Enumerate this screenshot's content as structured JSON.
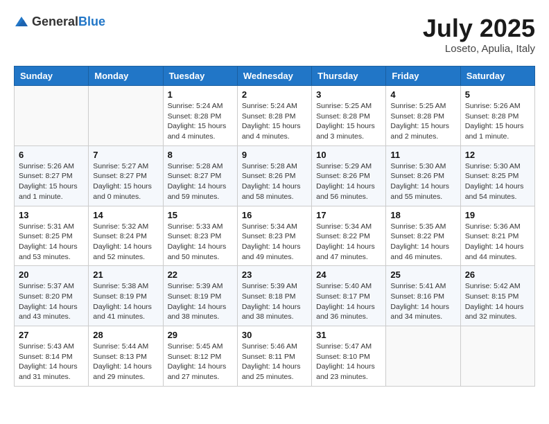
{
  "header": {
    "logo_general": "General",
    "logo_blue": "Blue",
    "month_year": "July 2025",
    "location": "Loseto, Apulia, Italy"
  },
  "weekdays": [
    "Sunday",
    "Monday",
    "Tuesday",
    "Wednesday",
    "Thursday",
    "Friday",
    "Saturday"
  ],
  "weeks": [
    [
      {
        "day": "",
        "sunrise": "",
        "sunset": "",
        "daylight": ""
      },
      {
        "day": "",
        "sunrise": "",
        "sunset": "",
        "daylight": ""
      },
      {
        "day": "1",
        "sunrise": "Sunrise: 5:24 AM",
        "sunset": "Sunset: 8:28 PM",
        "daylight": "Daylight: 15 hours and 4 minutes."
      },
      {
        "day": "2",
        "sunrise": "Sunrise: 5:24 AM",
        "sunset": "Sunset: 8:28 PM",
        "daylight": "Daylight: 15 hours and 4 minutes."
      },
      {
        "day": "3",
        "sunrise": "Sunrise: 5:25 AM",
        "sunset": "Sunset: 8:28 PM",
        "daylight": "Daylight: 15 hours and 3 minutes."
      },
      {
        "day": "4",
        "sunrise": "Sunrise: 5:25 AM",
        "sunset": "Sunset: 8:28 PM",
        "daylight": "Daylight: 15 hours and 2 minutes."
      },
      {
        "day": "5",
        "sunrise": "Sunrise: 5:26 AM",
        "sunset": "Sunset: 8:28 PM",
        "daylight": "Daylight: 15 hours and 1 minute."
      }
    ],
    [
      {
        "day": "6",
        "sunrise": "Sunrise: 5:26 AM",
        "sunset": "Sunset: 8:27 PM",
        "daylight": "Daylight: 15 hours and 1 minute."
      },
      {
        "day": "7",
        "sunrise": "Sunrise: 5:27 AM",
        "sunset": "Sunset: 8:27 PM",
        "daylight": "Daylight: 15 hours and 0 minutes."
      },
      {
        "day": "8",
        "sunrise": "Sunrise: 5:28 AM",
        "sunset": "Sunset: 8:27 PM",
        "daylight": "Daylight: 14 hours and 59 minutes."
      },
      {
        "day": "9",
        "sunrise": "Sunrise: 5:28 AM",
        "sunset": "Sunset: 8:26 PM",
        "daylight": "Daylight: 14 hours and 58 minutes."
      },
      {
        "day": "10",
        "sunrise": "Sunrise: 5:29 AM",
        "sunset": "Sunset: 8:26 PM",
        "daylight": "Daylight: 14 hours and 56 minutes."
      },
      {
        "day": "11",
        "sunrise": "Sunrise: 5:30 AM",
        "sunset": "Sunset: 8:26 PM",
        "daylight": "Daylight: 14 hours and 55 minutes."
      },
      {
        "day": "12",
        "sunrise": "Sunrise: 5:30 AM",
        "sunset": "Sunset: 8:25 PM",
        "daylight": "Daylight: 14 hours and 54 minutes."
      }
    ],
    [
      {
        "day": "13",
        "sunrise": "Sunrise: 5:31 AM",
        "sunset": "Sunset: 8:25 PM",
        "daylight": "Daylight: 14 hours and 53 minutes."
      },
      {
        "day": "14",
        "sunrise": "Sunrise: 5:32 AM",
        "sunset": "Sunset: 8:24 PM",
        "daylight": "Daylight: 14 hours and 52 minutes."
      },
      {
        "day": "15",
        "sunrise": "Sunrise: 5:33 AM",
        "sunset": "Sunset: 8:23 PM",
        "daylight": "Daylight: 14 hours and 50 minutes."
      },
      {
        "day": "16",
        "sunrise": "Sunrise: 5:34 AM",
        "sunset": "Sunset: 8:23 PM",
        "daylight": "Daylight: 14 hours and 49 minutes."
      },
      {
        "day": "17",
        "sunrise": "Sunrise: 5:34 AM",
        "sunset": "Sunset: 8:22 PM",
        "daylight": "Daylight: 14 hours and 47 minutes."
      },
      {
        "day": "18",
        "sunrise": "Sunrise: 5:35 AM",
        "sunset": "Sunset: 8:22 PM",
        "daylight": "Daylight: 14 hours and 46 minutes."
      },
      {
        "day": "19",
        "sunrise": "Sunrise: 5:36 AM",
        "sunset": "Sunset: 8:21 PM",
        "daylight": "Daylight: 14 hours and 44 minutes."
      }
    ],
    [
      {
        "day": "20",
        "sunrise": "Sunrise: 5:37 AM",
        "sunset": "Sunset: 8:20 PM",
        "daylight": "Daylight: 14 hours and 43 minutes."
      },
      {
        "day": "21",
        "sunrise": "Sunrise: 5:38 AM",
        "sunset": "Sunset: 8:19 PM",
        "daylight": "Daylight: 14 hours and 41 minutes."
      },
      {
        "day": "22",
        "sunrise": "Sunrise: 5:39 AM",
        "sunset": "Sunset: 8:19 PM",
        "daylight": "Daylight: 14 hours and 38 minutes."
      },
      {
        "day": "23",
        "sunrise": "Sunrise: 5:39 AM",
        "sunset": "Sunset: 8:18 PM",
        "daylight": "Daylight: 14 hours and 38 minutes."
      },
      {
        "day": "24",
        "sunrise": "Sunrise: 5:40 AM",
        "sunset": "Sunset: 8:17 PM",
        "daylight": "Daylight: 14 hours and 36 minutes."
      },
      {
        "day": "25",
        "sunrise": "Sunrise: 5:41 AM",
        "sunset": "Sunset: 8:16 PM",
        "daylight": "Daylight: 14 hours and 34 minutes."
      },
      {
        "day": "26",
        "sunrise": "Sunrise: 5:42 AM",
        "sunset": "Sunset: 8:15 PM",
        "daylight": "Daylight: 14 hours and 32 minutes."
      }
    ],
    [
      {
        "day": "27",
        "sunrise": "Sunrise: 5:43 AM",
        "sunset": "Sunset: 8:14 PM",
        "daylight": "Daylight: 14 hours and 31 minutes."
      },
      {
        "day": "28",
        "sunrise": "Sunrise: 5:44 AM",
        "sunset": "Sunset: 8:13 PM",
        "daylight": "Daylight: 14 hours and 29 minutes."
      },
      {
        "day": "29",
        "sunrise": "Sunrise: 5:45 AM",
        "sunset": "Sunset: 8:12 PM",
        "daylight": "Daylight: 14 hours and 27 minutes."
      },
      {
        "day": "30",
        "sunrise": "Sunrise: 5:46 AM",
        "sunset": "Sunset: 8:11 PM",
        "daylight": "Daylight: 14 hours and 25 minutes."
      },
      {
        "day": "31",
        "sunrise": "Sunrise: 5:47 AM",
        "sunset": "Sunset: 8:10 PM",
        "daylight": "Daylight: 14 hours and 23 minutes."
      },
      {
        "day": "",
        "sunrise": "",
        "sunset": "",
        "daylight": ""
      },
      {
        "day": "",
        "sunrise": "",
        "sunset": "",
        "daylight": ""
      }
    ]
  ]
}
